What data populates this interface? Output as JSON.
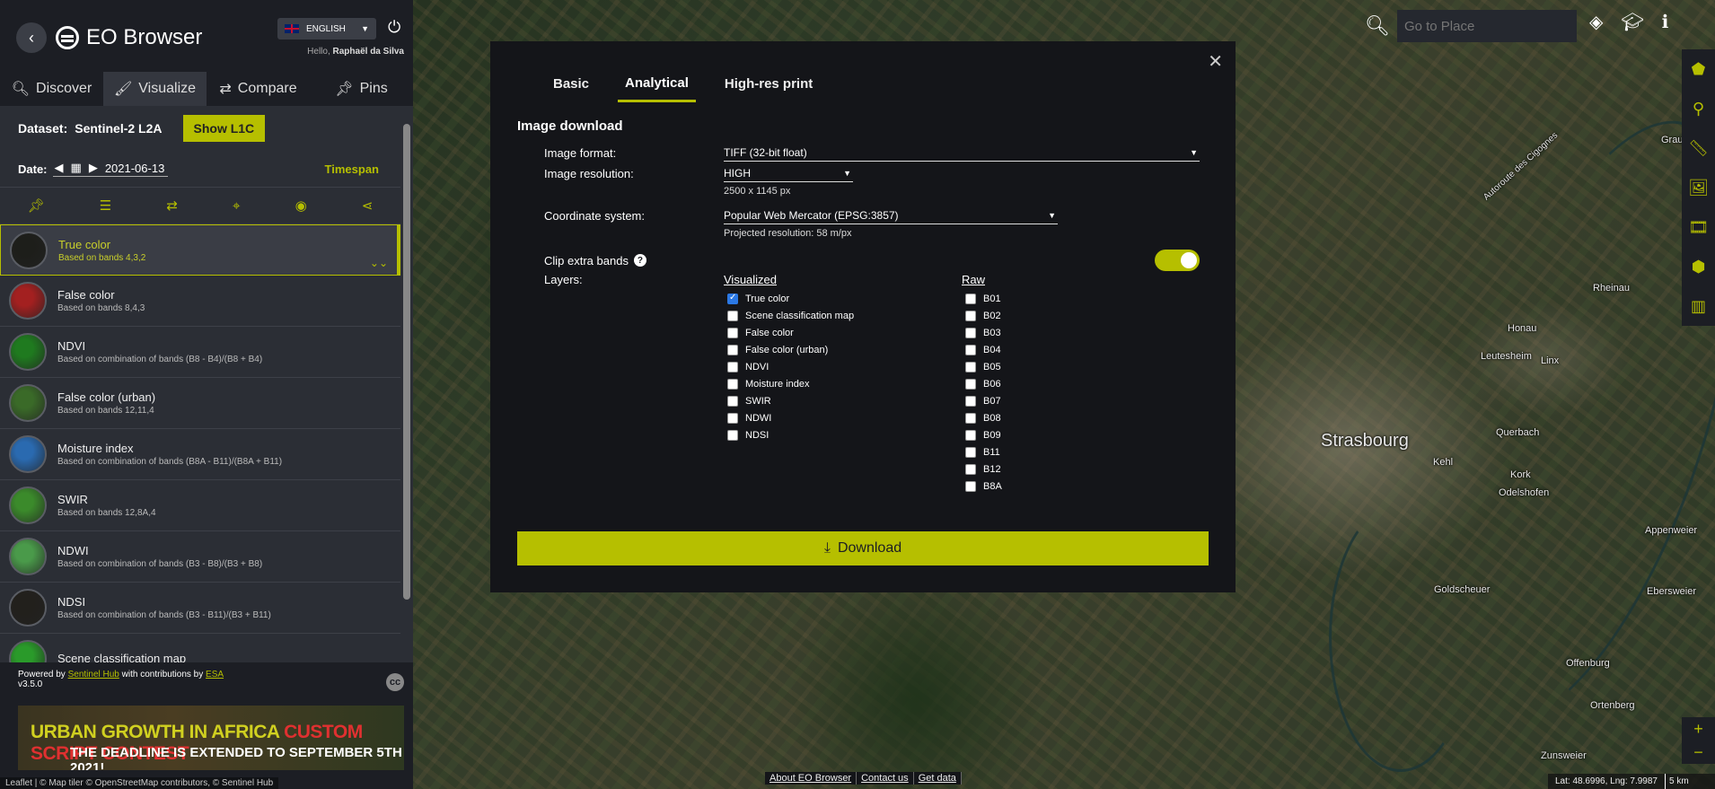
{
  "header": {
    "logo_text": "EO Browser",
    "language": "ENGLISH",
    "hello_prefix": "Hello,",
    "user_name": "Raphaël da Silva"
  },
  "tabs": [
    {
      "label": "Discover",
      "icon": "search-icon"
    },
    {
      "label": "Visualize",
      "icon": "brush-icon"
    },
    {
      "label": "Compare",
      "icon": "arrows-icon"
    },
    {
      "label": "Pins",
      "icon": "pin-icon"
    }
  ],
  "dataset": {
    "label": "Dataset:",
    "name": "Sentinel-2 L2A",
    "toggle_button": "Show L1C"
  },
  "date": {
    "label": "Date:",
    "value": "2021-06-13",
    "timespan": "Timespan"
  },
  "layers": [
    {
      "title": "True color",
      "subtitle": "Based on bands 4,3,2",
      "color": "#1d1e1a"
    },
    {
      "title": "False color",
      "subtitle": "Based on bands 8,4,3",
      "color": "#a32020"
    },
    {
      "title": "NDVI",
      "subtitle": "Based on combination of bands (B8 - B4)/(B8 + B4)",
      "color": "#1f7a1f"
    },
    {
      "title": "False color (urban)",
      "subtitle": "Based on bands 12,11,4",
      "color": "#3a6a28"
    },
    {
      "title": "Moisture index",
      "subtitle": "Based on combination of bands (B8A - B11)/(B8A + B11)",
      "color": "#2a6ab0"
    },
    {
      "title": "SWIR",
      "subtitle": "Based on bands 12,8A,4",
      "color": "#3b8a2b"
    },
    {
      "title": "NDWI",
      "subtitle": "Based on combination of bands (B3 - B8)/(B3 + B8)",
      "color": "#4a9a4a"
    },
    {
      "title": "NDSI",
      "subtitle": "Based on combination of bands (B3 - B11)/(B3 + B11)",
      "color": "#22201c"
    },
    {
      "title": "Scene classification map",
      "subtitle": "",
      "color": "#2a9a2a"
    }
  ],
  "footer": {
    "powered_by": "Powered by",
    "sentinel_hub": "Sentinel Hub",
    "with_contrib": "with contributions by",
    "esa": "ESA",
    "version": "v3.5.0",
    "banner_line1_a": "URBAN GROWTH IN AFRICA",
    "banner_line1_b": "CUSTOM SCRIPT CONTEST",
    "banner_line2": "THE DEADLINE IS EXTENDED TO SEPTEMBER 5TH 2021!",
    "leaflet": "Leaflet | © Map tiler © OpenStreetMap contributors, © Sentinel Hub"
  },
  "modal": {
    "tabs": [
      "Basic",
      "Analytical",
      "High-res print"
    ],
    "active_tab": "Analytical",
    "title": "Image download",
    "format_label": "Image format:",
    "format_value": "TIFF (32-bit float)",
    "resolution_label": "Image resolution:",
    "resolution_value": "HIGH",
    "resolution_px": "2500 x 1145 px",
    "crs_label": "Coordinate system:",
    "crs_value": "Popular Web Mercator (EPSG:3857)",
    "projected_res": "Projected resolution: 58 m/px",
    "clip_label": "Clip extra bands",
    "layers_label": "Layers:",
    "visualized_header": "Visualized",
    "raw_header": "Raw",
    "visualized": [
      {
        "label": "True color",
        "checked": true
      },
      {
        "label": "Scene classification map",
        "checked": false
      },
      {
        "label": "False color",
        "checked": false
      },
      {
        "label": "False color (urban)",
        "checked": false
      },
      {
        "label": "NDVI",
        "checked": false
      },
      {
        "label": "Moisture index",
        "checked": false
      },
      {
        "label": "SWIR",
        "checked": false
      },
      {
        "label": "NDWI",
        "checked": false
      },
      {
        "label": "NDSI",
        "checked": false
      }
    ],
    "raw": [
      "B01",
      "B02",
      "B03",
      "B04",
      "B05",
      "B06",
      "B07",
      "B08",
      "B09",
      "B11",
      "B12",
      "B8A"
    ],
    "download_label": "Download"
  },
  "map": {
    "search_placeholder": "Go to Place",
    "labels": {
      "strasbourg": "Strasbourg",
      "grauelsbaum": "Grauelsbaum",
      "autoroute": "Autoroute des Cigognes",
      "rheinau": "Rheinau",
      "honau": "Honau",
      "leutesheim": "Leutesheim",
      "linx": "Linx",
      "querbach": "Querbach",
      "kehl": "Kehl",
      "kork": "Kork",
      "odelshofen": "Odelshofen",
      "appenweier": "Appenweier",
      "goldscheuer": "Goldscheuer",
      "ebersweier": "Ebersweier",
      "offenburg": "Offenburg",
      "ortenberg": "Ortenberg",
      "zunsweier": "Zunsweier"
    },
    "bottom_links": [
      "About EO Browser",
      "Contact us",
      "Get data"
    ],
    "coords": "Lat: 48.6996, Lng: 7.9987",
    "scale": "5 km"
  }
}
